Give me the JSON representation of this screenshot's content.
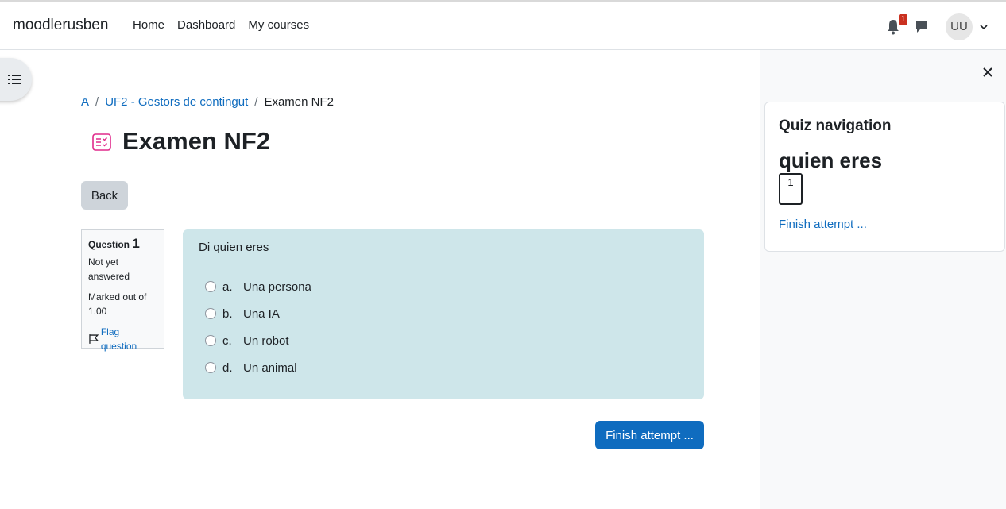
{
  "header": {
    "brand": "moodlerusben",
    "nav": [
      "Home",
      "Dashboard",
      "My courses"
    ],
    "notification_count": "1",
    "avatar_initials": "UU"
  },
  "breadcrumb": {
    "items": [
      "A",
      "UF2 - Gestors de contingut"
    ],
    "current": "Examen NF2"
  },
  "page": {
    "title": "Examen NF2",
    "back_label": "Back",
    "finish_label": "Finish attempt ..."
  },
  "question": {
    "label": "Question",
    "number": "1",
    "state": "Not yet answered",
    "marks": "Marked out of 1.00",
    "flag_label": "Flag question",
    "text": "Di quien eres",
    "options": [
      {
        "letter": "a.",
        "text": "Una persona"
      },
      {
        "letter": "b.",
        "text": "Una IA"
      },
      {
        "letter": "c.",
        "text": "Un robot"
      },
      {
        "letter": "d.",
        "text": "Un animal"
      }
    ]
  },
  "quiz_nav": {
    "title": "Quiz navigation",
    "section": "quien eres",
    "buttons": [
      "1"
    ],
    "finish_link": "Finish attempt ..."
  },
  "colors": {
    "link": "#0f6cbf",
    "question_bg": "#cee6ea",
    "badge": "#ca3120",
    "activity_icon": "#e02a8b"
  }
}
